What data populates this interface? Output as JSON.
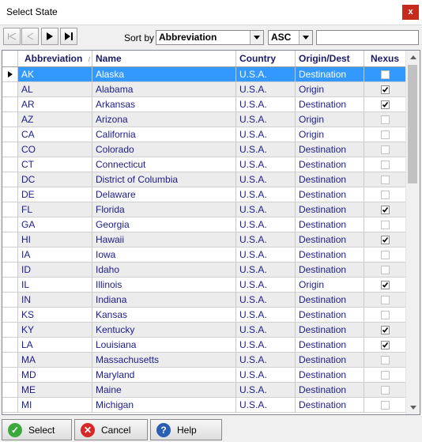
{
  "window": {
    "title": "Select State",
    "close_glyph": "x"
  },
  "toolbar": {
    "sort_by_label": "Sort by",
    "sort_field": "Abbreviation",
    "sort_order": "ASC",
    "filter_value": "",
    "icons": [
      "first-record-icon",
      "previous-record-icon",
      "next-record-icon",
      "last-record-icon"
    ]
  },
  "grid": {
    "columns": [
      "Abbreviation",
      "Name",
      "Country",
      "Origin/Dest",
      "Nexus"
    ],
    "sort_indicator": "/",
    "selected_row": 0,
    "rows": [
      {
        "abbr": "AK",
        "name": "Alaska",
        "country": "U.S.A.",
        "od": "Destination",
        "nexus": false
      },
      {
        "abbr": "AL",
        "name": "Alabama",
        "country": "U.S.A.",
        "od": "Origin",
        "nexus": true
      },
      {
        "abbr": "AR",
        "name": "Arkansas",
        "country": "U.S.A.",
        "od": "Destination",
        "nexus": true
      },
      {
        "abbr": "AZ",
        "name": "Arizona",
        "country": "U.S.A.",
        "od": "Origin",
        "nexus": false
      },
      {
        "abbr": "CA",
        "name": "California",
        "country": "U.S.A.",
        "od": "Origin",
        "nexus": false
      },
      {
        "abbr": "CO",
        "name": "Colorado",
        "country": "U.S.A.",
        "od": "Destination",
        "nexus": false
      },
      {
        "abbr": "CT",
        "name": "Connecticut",
        "country": "U.S.A.",
        "od": "Destination",
        "nexus": false
      },
      {
        "abbr": "DC",
        "name": "District of Columbia",
        "country": "U.S.A.",
        "od": "Destination",
        "nexus": false
      },
      {
        "abbr": "DE",
        "name": "Delaware",
        "country": "U.S.A.",
        "od": "Destination",
        "nexus": false
      },
      {
        "abbr": "FL",
        "name": "Florida",
        "country": "U.S.A.",
        "od": "Destination",
        "nexus": true
      },
      {
        "abbr": "GA",
        "name": "Georgia",
        "country": "U.S.A.",
        "od": "Destination",
        "nexus": false
      },
      {
        "abbr": "HI",
        "name": "Hawaii",
        "country": "U.S.A.",
        "od": "Destination",
        "nexus": true
      },
      {
        "abbr": "IA",
        "name": "Iowa",
        "country": "U.S.A.",
        "od": "Destination",
        "nexus": false
      },
      {
        "abbr": "ID",
        "name": "Idaho",
        "country": "U.S.A.",
        "od": "Destination",
        "nexus": false
      },
      {
        "abbr": "IL",
        "name": "Illinois",
        "country": "U.S.A.",
        "od": "Origin",
        "nexus": true
      },
      {
        "abbr": "IN",
        "name": "Indiana",
        "country": "U.S.A.",
        "od": "Destination",
        "nexus": false
      },
      {
        "abbr": "KS",
        "name": "Kansas",
        "country": "U.S.A.",
        "od": "Destination",
        "nexus": false
      },
      {
        "abbr": "KY",
        "name": "Kentucky",
        "country": "U.S.A.",
        "od": "Destination",
        "nexus": true
      },
      {
        "abbr": "LA",
        "name": "Louisiana",
        "country": "U.S.A.",
        "od": "Destination",
        "nexus": true
      },
      {
        "abbr": "MA",
        "name": "Massachusetts",
        "country": "U.S.A.",
        "od": "Destination",
        "nexus": false
      },
      {
        "abbr": "MD",
        "name": "Maryland",
        "country": "U.S.A.",
        "od": "Destination",
        "nexus": false
      },
      {
        "abbr": "ME",
        "name": "Maine",
        "country": "U.S.A.",
        "od": "Destination",
        "nexus": false
      },
      {
        "abbr": "MI",
        "name": "Michigan",
        "country": "U.S.A.",
        "od": "Destination",
        "nexus": false
      }
    ]
  },
  "buttons": {
    "select": "Select",
    "cancel": "Cancel",
    "help": "Help"
  },
  "colors": {
    "selection": "#3399ff",
    "cell_text": "#1c1c8c",
    "header_text": "#1a1a6a"
  }
}
